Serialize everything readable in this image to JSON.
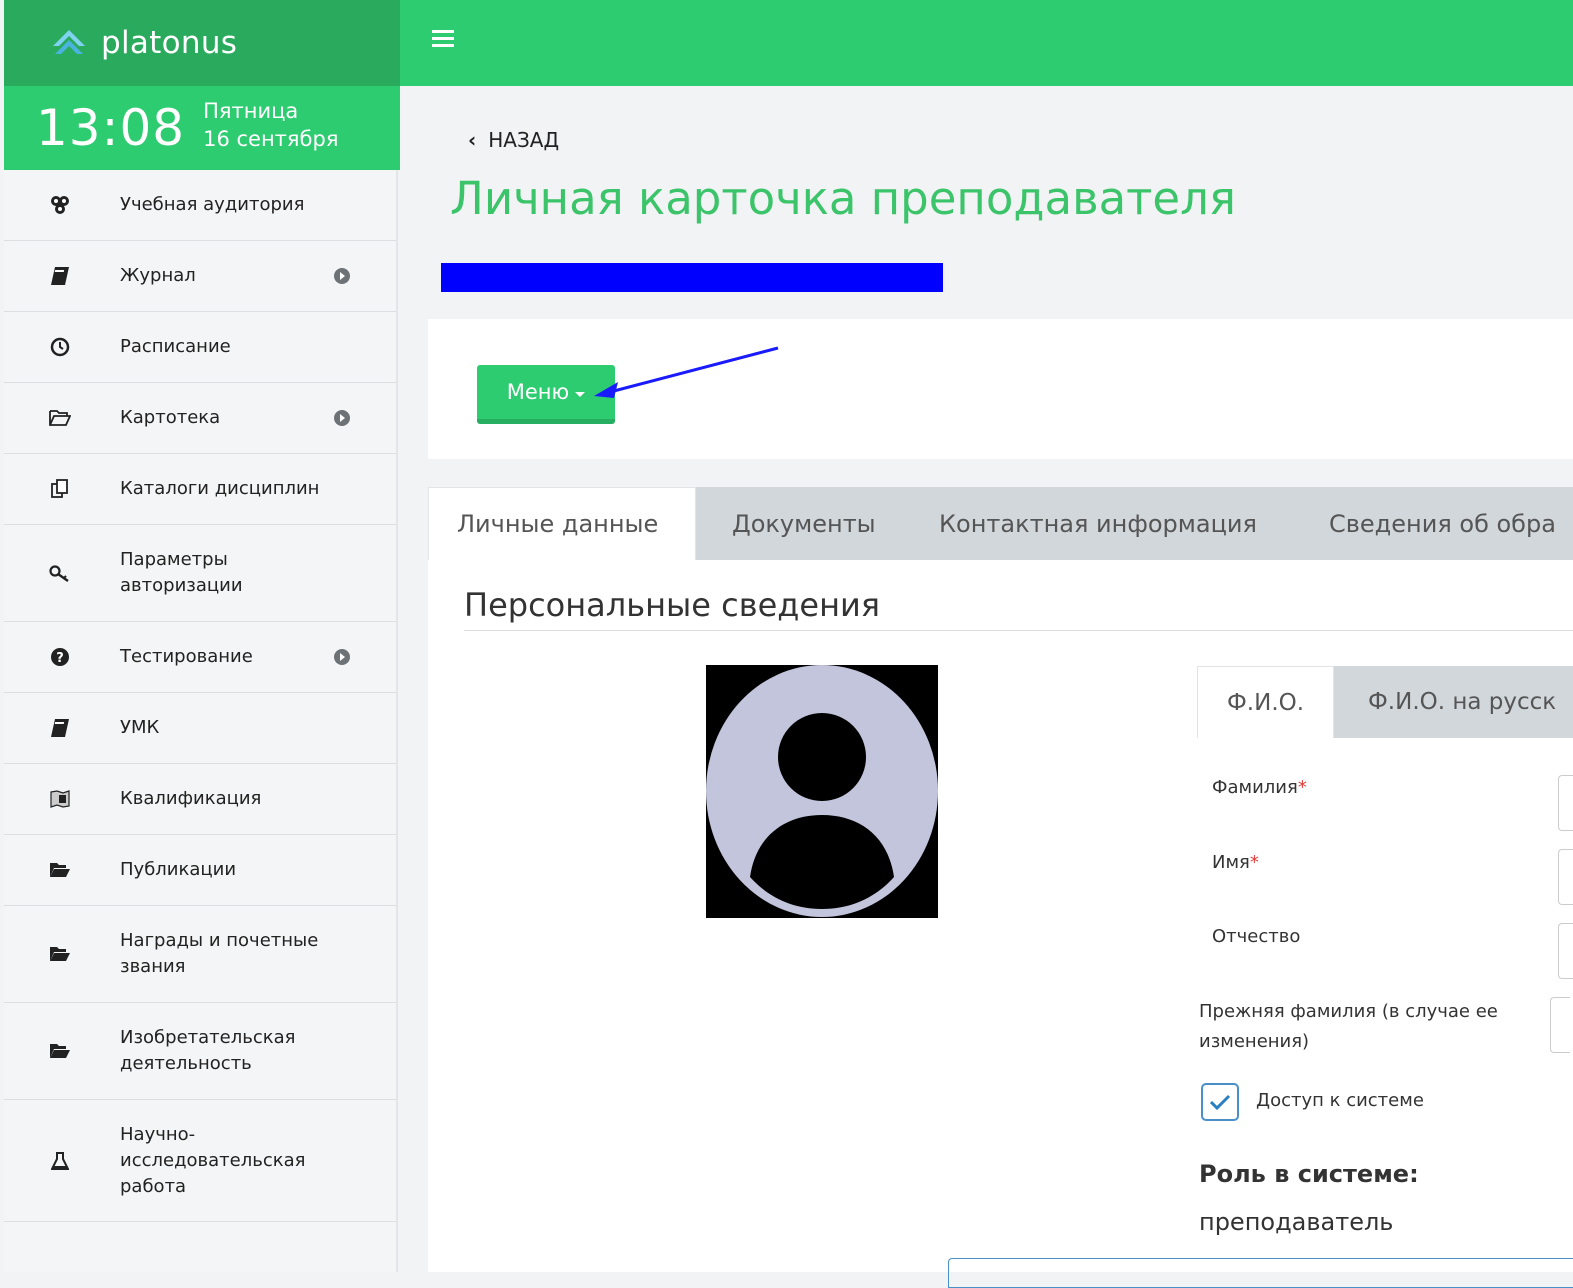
{
  "brand": {
    "name": "platonus",
    "header_color": "#2aaa5c",
    "accent": "#2ecc71"
  },
  "clock": {
    "time": "13:08",
    "weekday": "Пятница",
    "date": "16 сентября"
  },
  "sidebar": {
    "items": [
      {
        "label": "Учебная аудитория",
        "icon": "users-group-icon",
        "has_arrow": false
      },
      {
        "label": "Журнал",
        "icon": "book-icon",
        "has_arrow": true
      },
      {
        "label": "Расписание",
        "icon": "clock-icon",
        "has_arrow": false
      },
      {
        "label": "Картотека",
        "icon": "folder-open-icon",
        "has_arrow": true
      },
      {
        "label": "Каталоги дисциплин",
        "icon": "copy-icon",
        "has_arrow": false
      },
      {
        "label": "Параметры авторизации",
        "icon": "key-icon",
        "has_arrow": false
      },
      {
        "label": "Тестирование",
        "icon": "question-circle-icon",
        "has_arrow": true
      },
      {
        "label": "УМК",
        "icon": "book-icon",
        "has_arrow": false
      },
      {
        "label": "Квалификация",
        "icon": "map-icon",
        "has_arrow": false
      },
      {
        "label": "Публикации",
        "icon": "folder-icon",
        "has_arrow": false
      },
      {
        "label": "Награды и почетные звания",
        "icon": "folder-icon",
        "has_arrow": false
      },
      {
        "label": "Изобретательская деятельность",
        "icon": "folder-icon",
        "has_arrow": false
      },
      {
        "label": "Научно-исследовательская работа",
        "icon": "flask-icon",
        "has_arrow": false
      }
    ]
  },
  "page": {
    "back_label": "НАЗАД",
    "title": "Личная карточка преподавателя",
    "menu_button_label": "Меню"
  },
  "tabs": [
    "Личные данные",
    "Документы",
    "Контактная информация",
    "Сведения об обра"
  ],
  "section": {
    "title": "Персональные сведения",
    "inner_tabs": [
      "Ф.И.О.",
      "Ф.И.О. на русск"
    ],
    "fields": [
      {
        "label": "Фамилия",
        "required": true
      },
      {
        "label": "Имя",
        "required": true
      },
      {
        "label": "Отчество",
        "required": false
      },
      {
        "label": "Прежняя фамилия (в случае ее изменения)",
        "required": false
      }
    ],
    "access_label": "Доступ к системе",
    "access_checked": true,
    "role_heading": "Роль в системе:",
    "role_value": "преподаватель"
  }
}
